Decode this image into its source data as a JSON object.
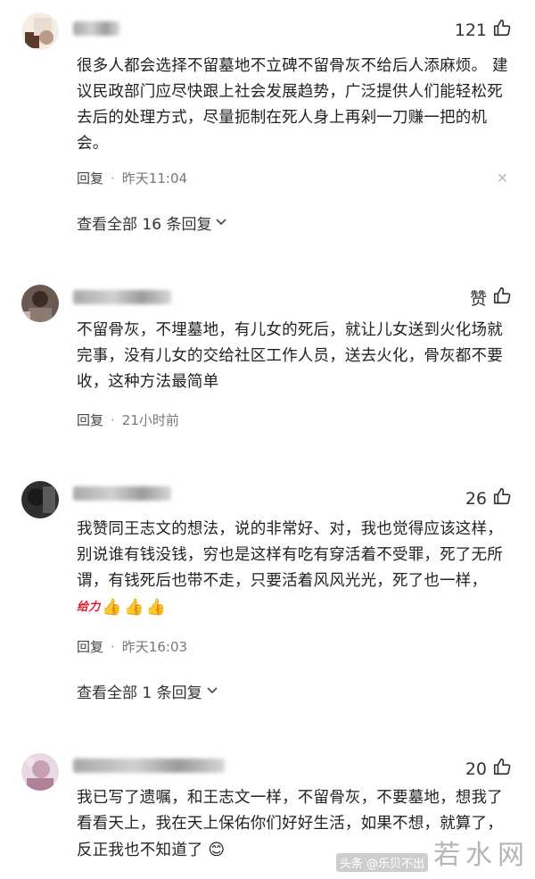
{
  "comments": [
    {
      "likes": "121",
      "text": "很多人都会选择不留墓地不立碑不留骨灰不给后人添麻烦。 建议民政部门应尽快跟上社会发展趋势，广泛提供人们能轻松死去后的处理方式，尽量扼制在死人身上再剁一刀赚一把的机会。",
      "reply_label": "回复",
      "dot": "·",
      "time": "昨天11:04",
      "more": "查看全部 16 条回复"
    },
    {
      "likes": "赞",
      "text": "不留骨灰，不埋墓地，有儿女的死后，就让儿女送到火化场就完事，没有儿女的交给社区工作人员，送去火化，骨灰都不要收，这种方法最简单",
      "reply_label": "回复",
      "dot": "·",
      "time": "21小时前"
    },
    {
      "likes": "26",
      "text": "我赞同王志文的想法，说的非常好、对，我也觉得应该这样，别说谁有钱没钱，穷也是这样有吃有穿活着不受罪，死了无所谓，有钱死后也带不走，只要活着风风光光，死了也一样，",
      "sticker": "给力",
      "reply_label": "回复",
      "dot": "·",
      "time": "昨天16:03",
      "more": "查看全部 1 条回复"
    },
    {
      "likes": "20",
      "text": "我已写了遗嘱，和王志文一样，不留骨灰，不要墓地，想我了看看天上，我在天上保佑你们好好生活，如果不想，就算了，反正我也不知道了"
    }
  ],
  "watermark": {
    "big": "若水网",
    "small": "头条 @乐贝不出"
  },
  "colors": {
    "text": "#222222",
    "muted": "#777777",
    "divider": "#eeeeee"
  },
  "icons": {
    "like": "thumbs-up-icon",
    "close": "close-icon",
    "expand": "chevron-down-icon"
  }
}
